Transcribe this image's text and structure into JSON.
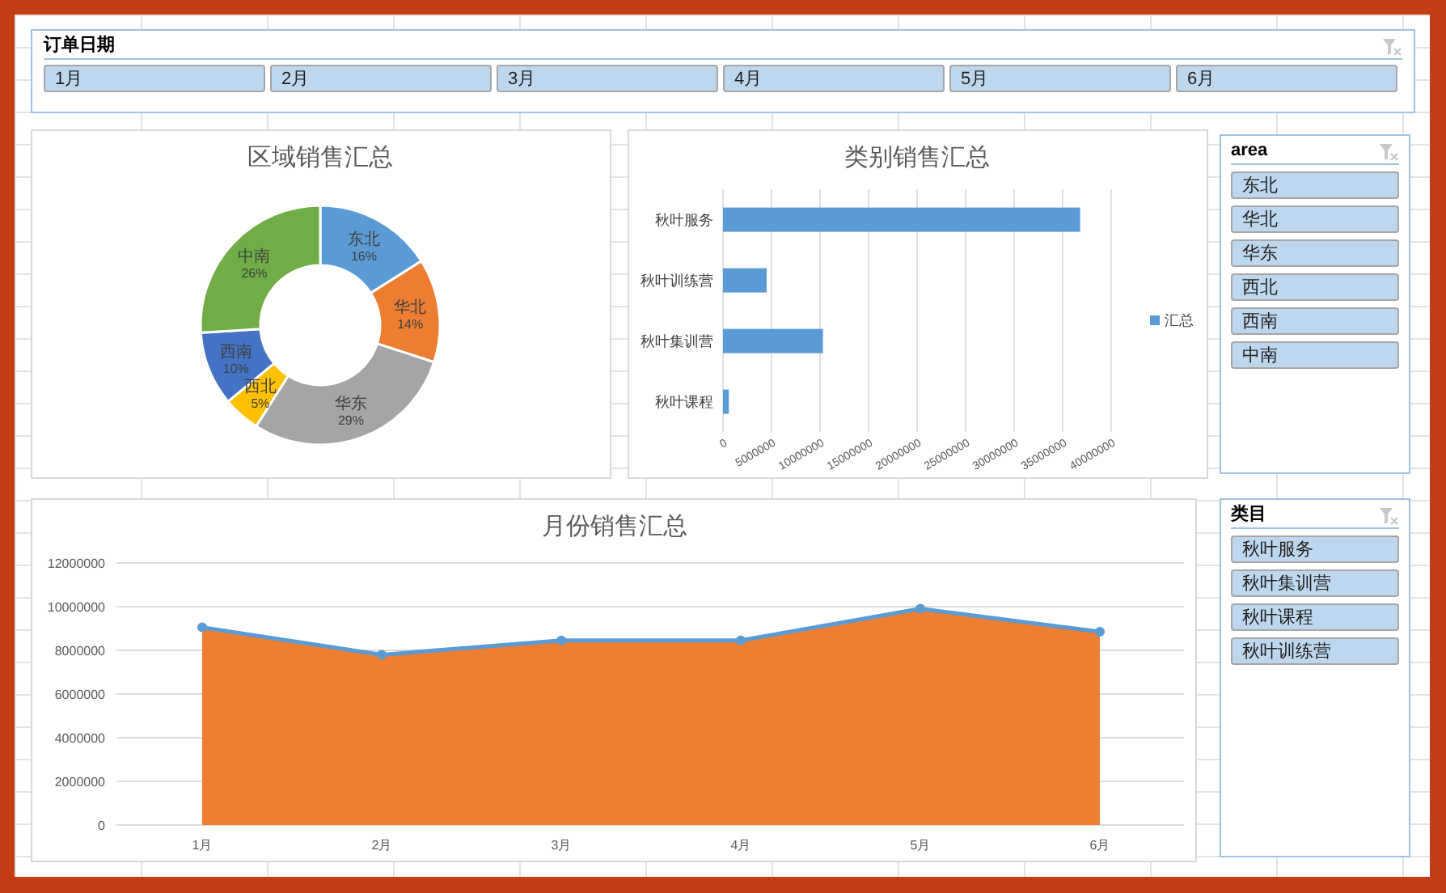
{
  "order_date_slicer": {
    "title": "订单日期",
    "items": [
      {
        "label": "1月",
        "selected": true
      },
      {
        "label": "2月",
        "selected": true
      },
      {
        "label": "3月",
        "selected": true
      },
      {
        "label": "4月",
        "selected": true
      },
      {
        "label": "5月",
        "selected": true
      },
      {
        "label": "6月",
        "selected": true
      }
    ]
  },
  "region_chart": {
    "chart_data": {
      "type": "donut",
      "title": "区域销售汇总",
      "categories": [
        "东北",
        "华北",
        "华东",
        "西北",
        "西南",
        "中南"
      ],
      "values": [
        16,
        14,
        29,
        5,
        10,
        26
      ],
      "value_labels": [
        "16%",
        "14%",
        "29%",
        "5%",
        "10%",
        "26%"
      ],
      "colors": [
        "#5b9bd5",
        "#ed7d31",
        "#a5a5a5",
        "#ffc000",
        "#4472c4",
        "#70ad47"
      ]
    }
  },
  "category_chart": {
    "chart_data": {
      "type": "bar",
      "orientation": "horizontal",
      "title": "类别销售汇总",
      "categories": [
        "秋叶服务",
        "秋叶训练营",
        "秋叶集训营",
        "秋叶课程"
      ],
      "series": [
        {
          "name": "汇总",
          "color": "#5b9bd5",
          "values": [
            36800000,
            4500000,
            10300000,
            600000
          ]
        }
      ],
      "grid": true,
      "xlim": [
        0,
        40000000
      ],
      "xticks": [
        0,
        5000000,
        10000000,
        15000000,
        20000000,
        25000000,
        30000000,
        35000000,
        40000000
      ]
    }
  },
  "area_slicer": {
    "title": "area",
    "items": [
      {
        "label": "东北",
        "selected": true
      },
      {
        "label": "华北",
        "selected": true
      },
      {
        "label": "华东",
        "selected": true
      },
      {
        "label": "西北",
        "selected": true
      },
      {
        "label": "西南",
        "selected": true
      },
      {
        "label": "中南",
        "selected": true
      }
    ]
  },
  "month_chart": {
    "chart_data": {
      "type": "area",
      "title": "月份销售汇总",
      "categories": [
        "1月",
        "2月",
        "3月",
        "4月",
        "5月",
        "6月"
      ],
      "series": [
        {
          "type": "area",
          "color": "#ed7d31",
          "values": [
            9050000,
            7800000,
            8450000,
            8450000,
            9900000,
            8850000
          ]
        },
        {
          "type": "line",
          "marker": "circle",
          "color": "#5b9bd5",
          "values": [
            9050000,
            7800000,
            8450000,
            8450000,
            9900000,
            8850000
          ]
        }
      ],
      "grid": true,
      "ylim": [
        0,
        12000000
      ],
      "yticks": [
        0,
        2000000,
        4000000,
        6000000,
        8000000,
        10000000,
        12000000
      ]
    }
  },
  "category_slicer": {
    "title": "类目",
    "items": [
      {
        "label": "秋叶服务",
        "selected": true
      },
      {
        "label": "秋叶集训营",
        "selected": true
      },
      {
        "label": "秋叶课程",
        "selected": true
      },
      {
        "label": "秋叶训练营",
        "selected": true
      }
    ]
  }
}
